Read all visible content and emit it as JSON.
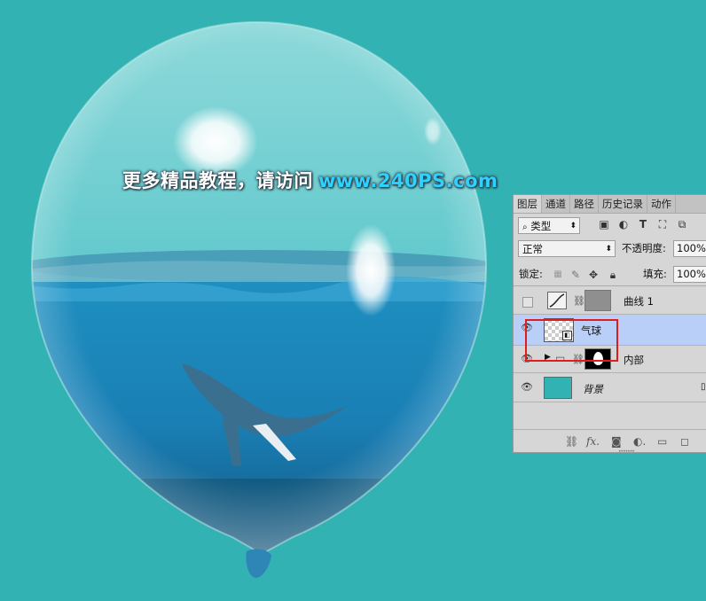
{
  "watermark": {
    "text": "更多精品教程，请访问",
    "url": "www.240PS.com"
  },
  "layers_panel": {
    "tabs": [
      {
        "label": "图层",
        "active": true
      },
      {
        "label": "通道",
        "active": false
      },
      {
        "label": "路径",
        "active": false
      },
      {
        "label": "历史记录",
        "active": false
      },
      {
        "label": "动作",
        "active": false
      }
    ],
    "filter": {
      "value": "类型"
    },
    "blend_mode": {
      "value": "正常"
    },
    "opacity": {
      "label": "不透明度:",
      "value": "100%"
    },
    "lock": {
      "label": "锁定:"
    },
    "fill": {
      "label": "填充:",
      "value": "100%"
    },
    "layers": [
      {
        "name": "曲线 1",
        "visible": false,
        "selected": false
      },
      {
        "name": "气球",
        "visible": true,
        "selected": true
      },
      {
        "name": "内部",
        "visible": true,
        "selected": false
      },
      {
        "name": "背景",
        "visible": true,
        "selected": false
      }
    ]
  },
  "colors": {
    "background": "#33b2b4",
    "panel": "#d6d6d6",
    "selected_layer": "#b9cff8",
    "highlight_box": "#e11c1c",
    "watermark_url": "#2fd2ff"
  }
}
